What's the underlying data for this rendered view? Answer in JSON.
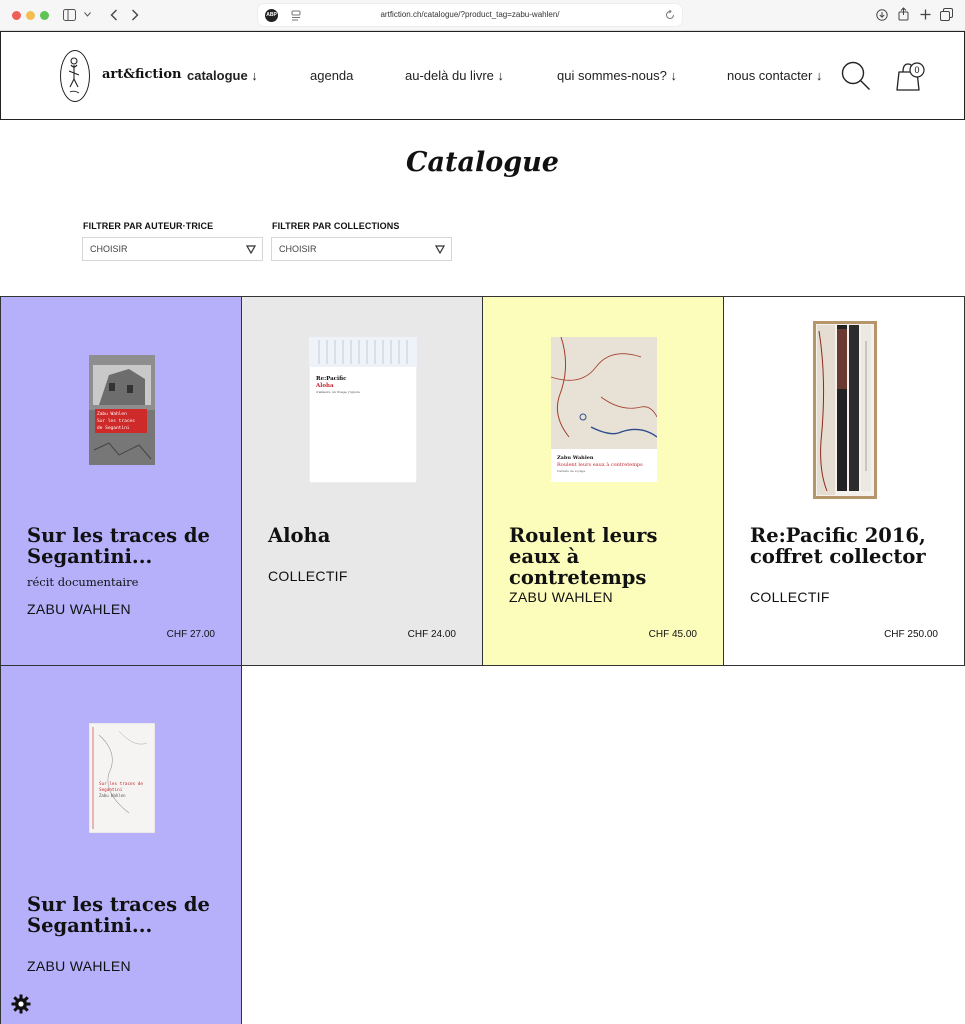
{
  "browser": {
    "url": "artfiction.ch/catalogue/?product_tag=zabu-wahlen/",
    "adblock_label": "ABP",
    "icons": [
      "sidebar-icon",
      "chevron-down-icon",
      "back-icon",
      "forward-icon",
      "reader-icon",
      "reload-icon",
      "download-icon",
      "share-icon",
      "new-tab-icon",
      "tabs-icon"
    ]
  },
  "header": {
    "brand": "art&fiction",
    "nav": [
      {
        "label": "catalogue ↓",
        "active": true
      },
      {
        "label": "agenda"
      },
      {
        "label": "au-delà du livre ↓"
      },
      {
        "label": "qui sommes-nous? ↓"
      },
      {
        "label": "nous contacter ↓"
      }
    ],
    "cart_count": "0"
  },
  "page": {
    "title": "Catalogue"
  },
  "filters": [
    {
      "label": "FILTRER PAR AUTEUR·TRICE",
      "value": "CHOISIR"
    },
    {
      "label": "FILTRER PAR COLLECTIONS",
      "value": "CHOISIR"
    }
  ],
  "products": [
    {
      "title": "Sur les traces de Segantini...",
      "subtitle": "récit documentaire",
      "author": "ZABU WAHLEN",
      "price": "CHF 27.00",
      "bg": "#b6b0fb",
      "cover_text": [
        "Zabu Wahlen",
        "Sur les traces",
        "de Segantini"
      ]
    },
    {
      "title": "Aloha",
      "subtitle": "",
      "author": "COLLECTIF",
      "price": "CHF 24.00",
      "bg": "#e8e8e8",
      "cover_text": [
        "Re:Pacific",
        "Aloha",
        "d'ailleurs, un rivage, j'ignore"
      ]
    },
    {
      "title": "Roulent leurs eaux à contretemps",
      "subtitle": "",
      "author": "ZABU WAHLEN",
      "price": "CHF 45.00",
      "bg": "#fdfdbb",
      "cover_text": [
        "Zabu Wahlen",
        "Roulent leurs eaux à contretemps",
        "Carnets de voyage"
      ]
    },
    {
      "title": "Re:Pacific 2016, coffret collector",
      "subtitle": "",
      "author": "COLLECTIF",
      "price": "CHF 250.00",
      "bg": "#ffffff"
    },
    {
      "title": "Sur les traces de Segantini...",
      "subtitle": "",
      "author": "ZABU WAHLEN",
      "price": "",
      "bg": "#b6b0fb",
      "cover_text": [
        "Sur les traces de",
        "Segantini",
        "Zabu Wahlen"
      ]
    }
  ]
}
